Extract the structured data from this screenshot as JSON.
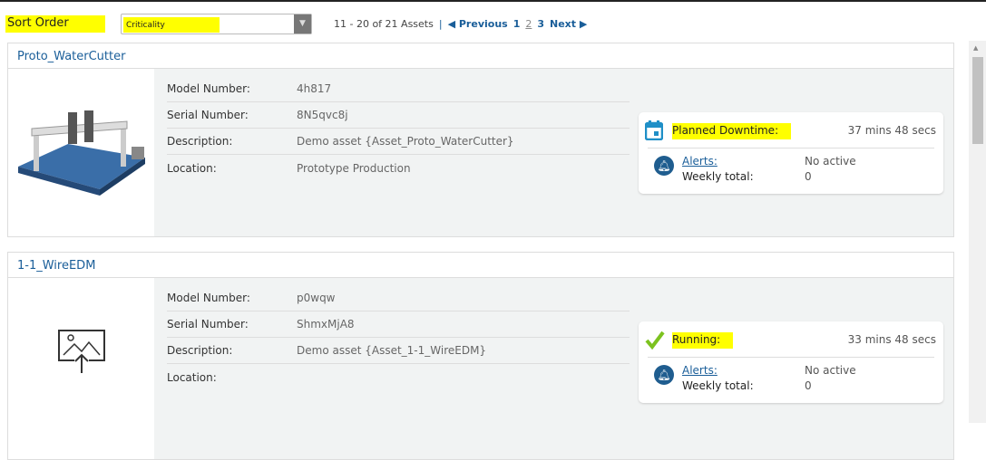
{
  "header": {
    "sort_label": "Sort Order",
    "sort_value": "Criticality",
    "range": "11 - 20 of 21 Assets",
    "separator": "|",
    "previous": "◀ Previous",
    "pages": [
      "1",
      "2",
      "3"
    ],
    "next": "Next ▶"
  },
  "assets": [
    {
      "name": "Proto_WaterCutter",
      "fields": [
        {
          "k": "Model Number:",
          "v": "4h817"
        },
        {
          "k": "Serial Number:",
          "v": "8N5qvc8j"
        },
        {
          "k": "Description:",
          "v": "Demo asset {Asset_Proto_WaterCutter}"
        },
        {
          "k": "Location:",
          "v": "Prototype Production"
        }
      ],
      "status": {
        "label": "Planned Downtime:",
        "time": "37 mins 48 secs",
        "icon": "calendar-icon",
        "alerts": "Alerts:",
        "alerts_value": "No active",
        "weekly": "Weekly total:",
        "weekly_value": "0"
      }
    },
    {
      "name": "1-1_WireEDM",
      "fields": [
        {
          "k": "Model Number:",
          "v": "p0wqw"
        },
        {
          "k": "Serial Number:",
          "v": "ShmxMjA8"
        },
        {
          "k": "Description:",
          "v": "Demo asset {Asset_1-1_WireEDM}"
        },
        {
          "k": "Location:",
          "v": ""
        }
      ],
      "status": {
        "label": "Running:",
        "time": "33 mins 48 secs",
        "icon": "checkmark-icon",
        "alerts": "Alerts:",
        "alerts_value": "No active",
        "weekly": "Weekly total:",
        "weekly_value": "0"
      }
    }
  ],
  "colors": {
    "link": "#1a5e99",
    "highlight": "#ffff00",
    "running": "#7cc21f",
    "calendar": "#1f8fc7"
  }
}
